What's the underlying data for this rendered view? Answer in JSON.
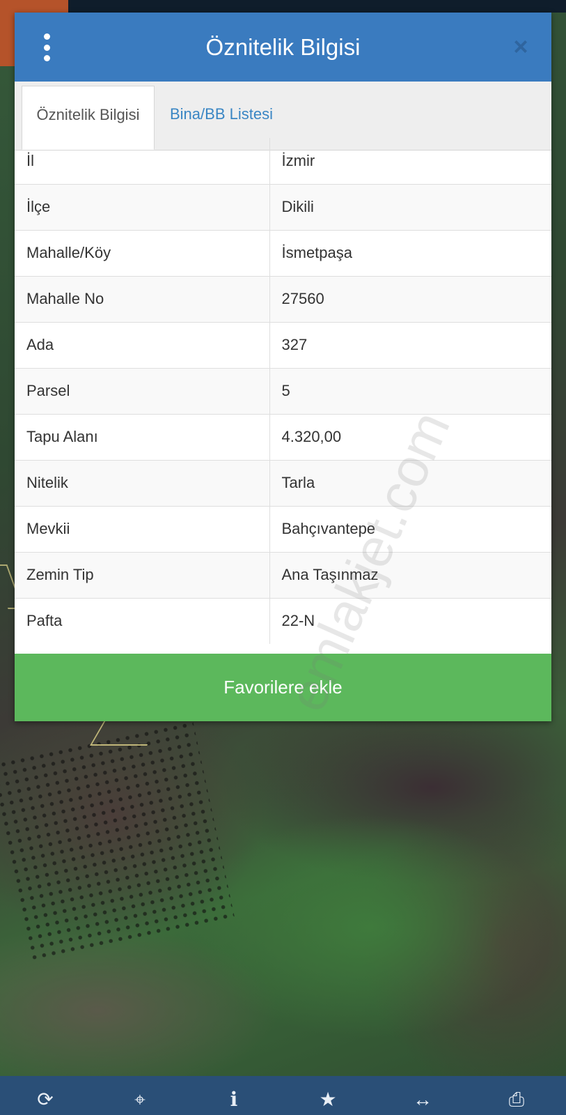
{
  "modal": {
    "title": "Öznitelik Bilgisi",
    "close_glyph": "×",
    "tabs": [
      {
        "label": "Öznitelik Bilgisi",
        "active": true
      },
      {
        "label": "Bina/BB Listesi",
        "active": false
      }
    ],
    "rows": [
      {
        "key": "İl",
        "value": "İzmir"
      },
      {
        "key": "İlçe",
        "value": "Dikili"
      },
      {
        "key": "Mahalle/Köy",
        "value": "İsmetpaşa"
      },
      {
        "key": "Mahalle No",
        "value": "27560"
      },
      {
        "key": "Ada",
        "value": "327"
      },
      {
        "key": "Parsel",
        "value": "5"
      },
      {
        "key": "Tapu Alanı",
        "value": "4.320,00"
      },
      {
        "key": "Nitelik",
        "value": "Tarla"
      },
      {
        "key": "Mevkii",
        "value": "Bahçıvantepe"
      },
      {
        "key": "Zemin Tip",
        "value": "Ana Taşınmaz"
      },
      {
        "key": "Pafta",
        "value": "22-N"
      }
    ],
    "favorite_button": "Favorilere ekle"
  },
  "watermark": "emlakjet.com",
  "toolbar": {
    "icons": [
      {
        "name": "refresh-icon",
        "glyph": "⟳"
      },
      {
        "name": "locate-icon",
        "glyph": "⌖"
      },
      {
        "name": "info-icon",
        "glyph": "i"
      },
      {
        "name": "star-icon",
        "glyph": "★"
      },
      {
        "name": "measure-icon",
        "glyph": "↔"
      },
      {
        "name": "print-icon",
        "glyph": "⎙"
      }
    ]
  },
  "colors": {
    "header": "#3a7bbf",
    "favorite": "#5cb85c",
    "toolbar": "#2a4f77",
    "tab_link": "#3a86c4"
  }
}
